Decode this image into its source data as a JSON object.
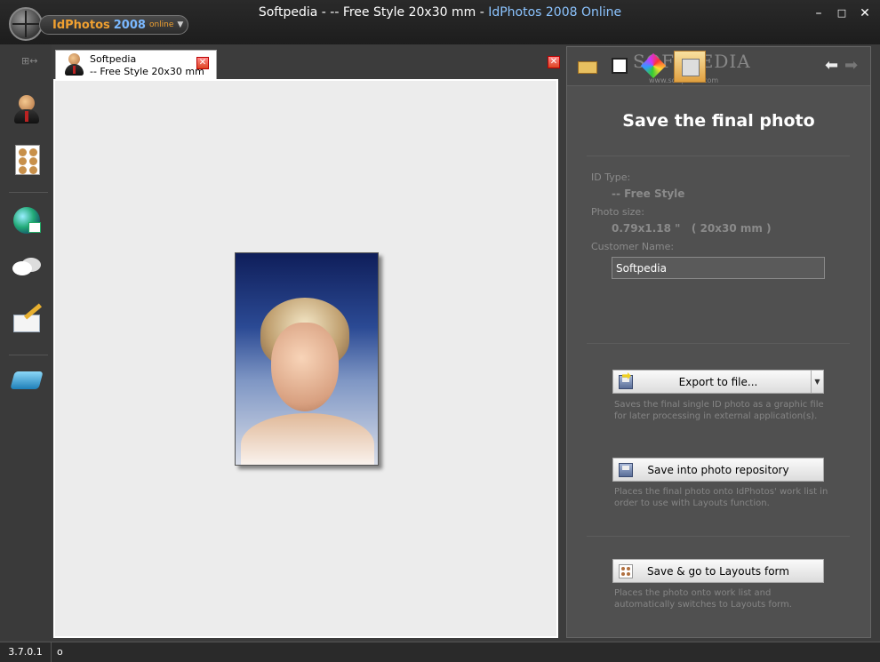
{
  "app": {
    "logo_name": "IdPhotos",
    "logo_year": "2008",
    "logo_edition": "online",
    "logo_arrow": "▼",
    "title_prefix": "Softpedia - -- Free Style 20x30 mm - ",
    "title_app": "IdPhotos 2008 Online"
  },
  "window_controls": {
    "minimize": "–",
    "maximize": "□",
    "close": "✕"
  },
  "sidebar": {
    "move_glyph": "⊞↔",
    "items": [
      {
        "name": "person",
        "icon": "person-icon"
      },
      {
        "name": "multi-photo",
        "icon": "photo-sheet-icon"
      },
      {
        "name": "web",
        "icon": "globe-home-icon"
      },
      {
        "name": "chat",
        "icon": "chat-bubbles-icon"
      },
      {
        "name": "email",
        "icon": "envelope-pencil-icon"
      },
      {
        "name": "help",
        "icon": "book-icon"
      }
    ]
  },
  "document_tab": {
    "name": "Softpedia",
    "subtitle": "-- Free Style 20x30 mm",
    "close_glyph": "✕"
  },
  "panel_close_glyph": "✕",
  "right_panel": {
    "watermark": "SOFTPEDIA",
    "watermark_url": "www.softpedia.com",
    "nav_back": "⬅",
    "nav_forward": "➡",
    "title": "Save the final photo",
    "id_type_label": "ID Type:",
    "id_type_value": "-- Free Style",
    "photo_size_label": "Photo size:",
    "photo_size_value": "0.79x1.18 \"   ( 20x30 mm )",
    "customer_name_label": "Customer Name:",
    "customer_name_value": "Softpedia",
    "actions": [
      {
        "label": "Export to file...",
        "dropdown": "▼",
        "description": "Saves the final single ID photo as a graphic file for later processing in external application(s)."
      },
      {
        "label": "Save into photo repository",
        "description": "Places the final photo onto IdPhotos' work list in order to use with Layouts function."
      },
      {
        "label": "Save & go to Layouts form",
        "description": "Places the photo onto work list and automatically switches to Layouts form."
      }
    ]
  },
  "statusbar": {
    "version": "3.7.0.1",
    "text": "o"
  },
  "colors": {
    "accent_orange": "#f0a030",
    "accent_blue": "#7ab8ff",
    "panel_bg": "#505050",
    "canvas_bg": "#ececec"
  }
}
